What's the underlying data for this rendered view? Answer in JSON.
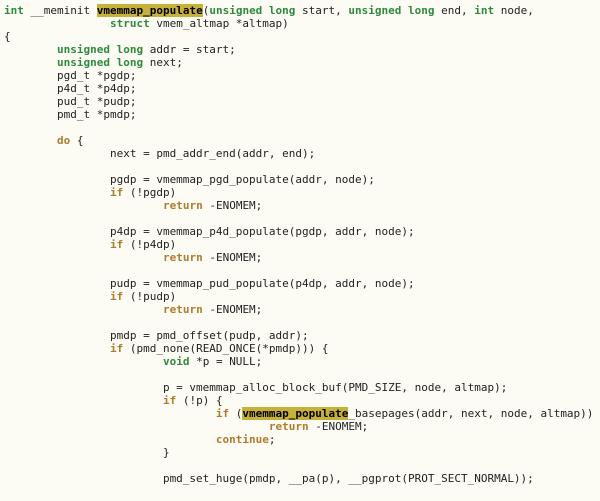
{
  "code": {
    "tokens": [
      {
        "c": "kw-type",
        "t": "int"
      },
      {
        "c": "plain",
        "t": " __meminit "
      },
      {
        "c": "hl",
        "t": "vmemmap_populate"
      },
      {
        "c": "plain",
        "t": "("
      },
      {
        "c": "kw-type",
        "t": "unsigned long"
      },
      {
        "c": "plain",
        "t": " start, "
      },
      {
        "c": "kw-type",
        "t": "unsigned long"
      },
      {
        "c": "plain",
        "t": " end, "
      },
      {
        "c": "kw-type",
        "t": "int"
      },
      {
        "c": "plain",
        "t": " node,"
      },
      {
        "c": "nl"
      },
      {
        "c": "plain",
        "t": "                "
      },
      {
        "c": "kw-type",
        "t": "struct"
      },
      {
        "c": "plain",
        "t": " vmem_altmap *altmap)"
      },
      {
        "c": "nl"
      },
      {
        "c": "plain",
        "t": "{"
      },
      {
        "c": "nl"
      },
      {
        "c": "plain",
        "t": "        "
      },
      {
        "c": "kw-type",
        "t": "unsigned long"
      },
      {
        "c": "plain",
        "t": " addr = start;"
      },
      {
        "c": "nl"
      },
      {
        "c": "plain",
        "t": "        "
      },
      {
        "c": "kw-type",
        "t": "unsigned long"
      },
      {
        "c": "plain",
        "t": " next;"
      },
      {
        "c": "nl"
      },
      {
        "c": "plain",
        "t": "        pgd_t *pgdp;"
      },
      {
        "c": "nl"
      },
      {
        "c": "plain",
        "t": "        p4d_t *p4dp;"
      },
      {
        "c": "nl"
      },
      {
        "c": "plain",
        "t": "        pud_t *pudp;"
      },
      {
        "c": "nl"
      },
      {
        "c": "plain",
        "t": "        pmd_t *pmdp;"
      },
      {
        "c": "nl"
      },
      {
        "c": "nl"
      },
      {
        "c": "plain",
        "t": "        "
      },
      {
        "c": "kw-flow",
        "t": "do"
      },
      {
        "c": "plain",
        "t": " {"
      },
      {
        "c": "nl"
      },
      {
        "c": "plain",
        "t": "                next = pmd_addr_end(addr, end);"
      },
      {
        "c": "nl"
      },
      {
        "c": "nl"
      },
      {
        "c": "plain",
        "t": "                pgdp = vmemmap_pgd_populate(addr, node);"
      },
      {
        "c": "nl"
      },
      {
        "c": "plain",
        "t": "                "
      },
      {
        "c": "kw-flow",
        "t": "if"
      },
      {
        "c": "plain",
        "t": " (!pgdp)"
      },
      {
        "c": "nl"
      },
      {
        "c": "plain",
        "t": "                        "
      },
      {
        "c": "kw-flow",
        "t": "return"
      },
      {
        "c": "plain",
        "t": " -ENOMEM;"
      },
      {
        "c": "nl"
      },
      {
        "c": "nl"
      },
      {
        "c": "plain",
        "t": "                p4dp = vmemmap_p4d_populate(pgdp, addr, node);"
      },
      {
        "c": "nl"
      },
      {
        "c": "plain",
        "t": "                "
      },
      {
        "c": "kw-flow",
        "t": "if"
      },
      {
        "c": "plain",
        "t": " (!p4dp)"
      },
      {
        "c": "nl"
      },
      {
        "c": "plain",
        "t": "                        "
      },
      {
        "c": "kw-flow",
        "t": "return"
      },
      {
        "c": "plain",
        "t": " -ENOMEM;"
      },
      {
        "c": "nl"
      },
      {
        "c": "nl"
      },
      {
        "c": "plain",
        "t": "                pudp = vmemmap_pud_populate(p4dp, addr, node);"
      },
      {
        "c": "nl"
      },
      {
        "c": "plain",
        "t": "                "
      },
      {
        "c": "kw-flow",
        "t": "if"
      },
      {
        "c": "plain",
        "t": " (!pudp)"
      },
      {
        "c": "nl"
      },
      {
        "c": "plain",
        "t": "                        "
      },
      {
        "c": "kw-flow",
        "t": "return"
      },
      {
        "c": "plain",
        "t": " -ENOMEM;"
      },
      {
        "c": "nl"
      },
      {
        "c": "nl"
      },
      {
        "c": "plain",
        "t": "                pmdp = pmd_offset(pudp, addr);"
      },
      {
        "c": "nl"
      },
      {
        "c": "plain",
        "t": "                "
      },
      {
        "c": "kw-flow",
        "t": "if"
      },
      {
        "c": "plain",
        "t": " (pmd_none(READ_ONCE(*pmdp))) {"
      },
      {
        "c": "nl"
      },
      {
        "c": "plain",
        "t": "                        "
      },
      {
        "c": "kw-type",
        "t": "void"
      },
      {
        "c": "plain",
        "t": " *p = NULL;"
      },
      {
        "c": "nl"
      },
      {
        "c": "nl"
      },
      {
        "c": "plain",
        "t": "                        p = vmemmap_alloc_block_buf(PMD_SIZE, node, altmap);"
      },
      {
        "c": "nl"
      },
      {
        "c": "plain",
        "t": "                        "
      },
      {
        "c": "kw-flow",
        "t": "if"
      },
      {
        "c": "plain",
        "t": " (!p) {"
      },
      {
        "c": "nl"
      },
      {
        "c": "plain",
        "t": "                                "
      },
      {
        "c": "kw-flow",
        "t": "if"
      },
      {
        "c": "plain",
        "t": " ("
      },
      {
        "c": "hl",
        "t": "vmemmap_populate"
      },
      {
        "c": "plain",
        "t": "_basepages(addr, next, node, altmap))"
      },
      {
        "c": "nl"
      },
      {
        "c": "plain",
        "t": "                                        "
      },
      {
        "c": "kw-flow",
        "t": "return"
      },
      {
        "c": "plain",
        "t": " -ENOMEM;"
      },
      {
        "c": "nl"
      },
      {
        "c": "plain",
        "t": "                                "
      },
      {
        "c": "kw-flow",
        "t": "continue"
      },
      {
        "c": "plain",
        "t": ";"
      },
      {
        "c": "nl"
      },
      {
        "c": "plain",
        "t": "                        }"
      },
      {
        "c": "nl"
      },
      {
        "c": "nl"
      },
      {
        "c": "plain",
        "t": "                        pmd_set_huge(pmdp, __pa(p), __pgprot(PROT_SECT_NORMAL));"
      },
      {
        "c": "nl"
      }
    ]
  }
}
